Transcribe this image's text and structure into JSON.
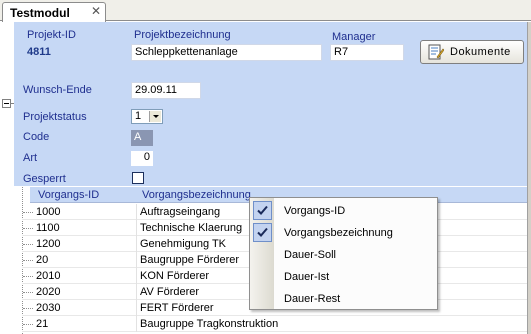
{
  "tab": {
    "title": "Testmodul",
    "close_glyph": "✕"
  },
  "header": {
    "project_id_label": "Projekt-ID",
    "project_id_value": "4811",
    "project_name_label": "Projektbezeichnung",
    "project_name_value": "Schleppkettenanlage",
    "manager_label": "Manager",
    "manager_value": "R7",
    "documents_button": "Dokumente",
    "documents_icon": "document-edit-icon"
  },
  "form": {
    "wish_end_label": "Wunsch-Ende",
    "wish_end_value": "29.09.11",
    "status_label": "Projektstatus",
    "status_value": "1",
    "code_label": "Code",
    "code_value": "A",
    "art_label": "Art",
    "art_value": "0",
    "locked_label": "Gesperrt"
  },
  "grid": {
    "columns": [
      "Vorgangs-ID",
      "Vorgangsbezeichnung"
    ],
    "rows": [
      {
        "id": "1000",
        "name": "Auftragseingang"
      },
      {
        "id": "1100",
        "name": "Technische Klaerung"
      },
      {
        "id": "1200",
        "name": "Genehmigung TK"
      },
      {
        "id": "20",
        "name": "Baugruppe Förderer"
      },
      {
        "id": "2010",
        "name": "KON Förderer"
      },
      {
        "id": "2020",
        "name": "AV Förderer"
      },
      {
        "id": "2030",
        "name": "FERT Förderer"
      },
      {
        "id": "21",
        "name": "Baugruppe Tragkonstruktion"
      }
    ]
  },
  "context_menu": {
    "items": [
      {
        "label": "Vorgangs-ID",
        "checked": true
      },
      {
        "label": "Vorgangsbezeichnung",
        "checked": true
      },
      {
        "label": "Dauer-Soll",
        "checked": false
      },
      {
        "label": "Dauer-Ist",
        "checked": false
      },
      {
        "label": "Dauer-Rest",
        "checked": false
      }
    ]
  },
  "colors": {
    "panel_bg": "#c6d8f5",
    "label_text": "#1f2f8f",
    "code_bg": "#8a96b2",
    "menu_check_bg": "#c3d3f0"
  }
}
